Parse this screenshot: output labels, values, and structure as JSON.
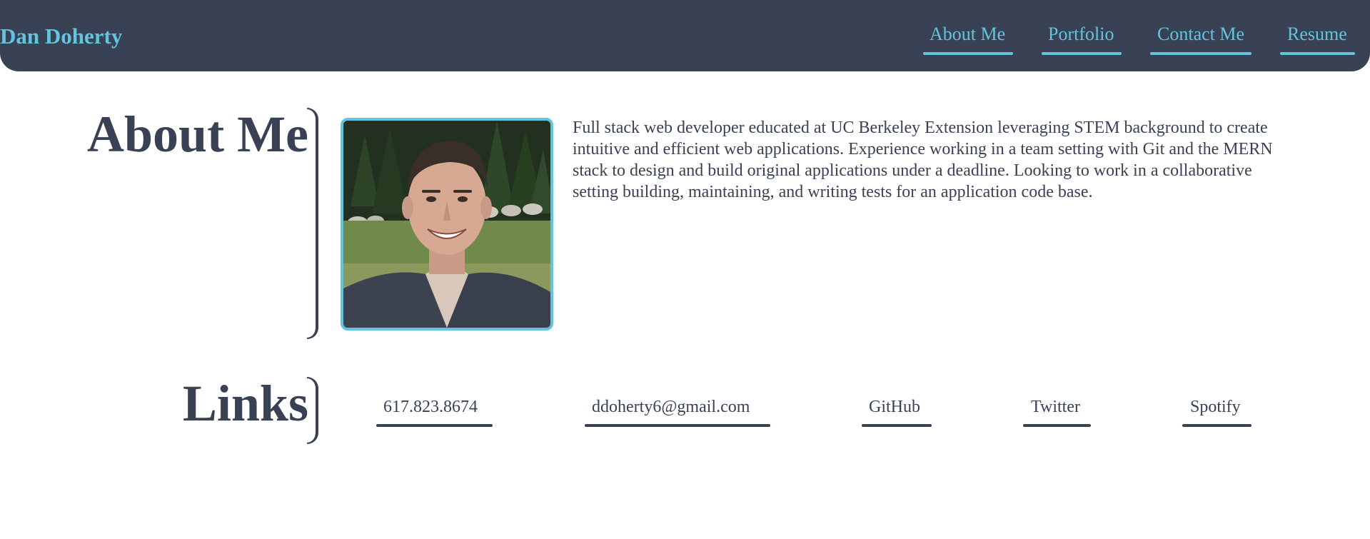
{
  "header": {
    "brand": "Dan Doherty",
    "nav": [
      {
        "label": "About Me"
      },
      {
        "label": "Portfolio"
      },
      {
        "label": "Contact Me"
      },
      {
        "label": "Resume"
      }
    ]
  },
  "about": {
    "title": "About Me",
    "bio": "Full stack web developer educated at UC Berkeley Extension leveraging STEM background to create intuitive and efficient web applications. Experience working in a team setting with Git and the MERN stack to design and build original applications under a deadline. Looking to work in a collaborative setting building, maintaining, and writing tests for an application code base."
  },
  "links": {
    "title": "Links",
    "items": [
      {
        "label": "617.823.8674"
      },
      {
        "label": "ddoherty6@gmail.com"
      },
      {
        "label": "GitHub"
      },
      {
        "label": "Twitter"
      },
      {
        "label": "Spotify"
      }
    ]
  },
  "colors": {
    "navy": "#394154",
    "accent": "#62c5dd",
    "background": "#ffffff"
  }
}
